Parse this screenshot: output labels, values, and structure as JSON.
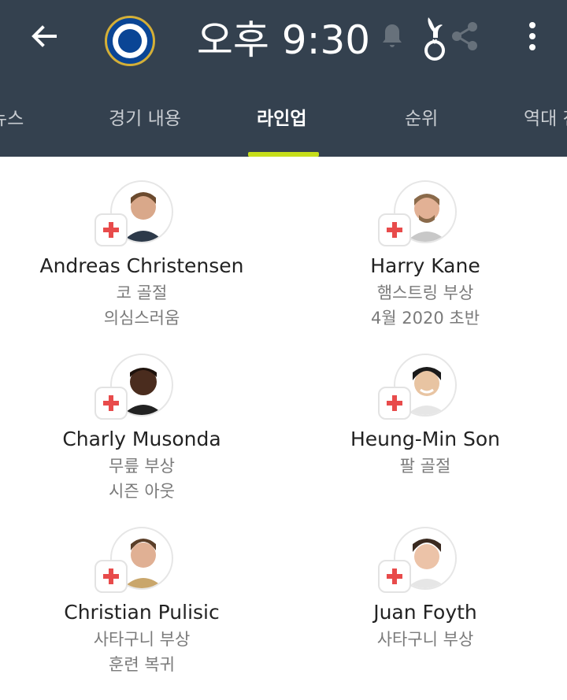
{
  "header": {
    "back_icon": "arrow-left-icon",
    "home_team_crest": "chelsea-crest-icon",
    "match_time": "오후 9:30",
    "away_team_crest": "tottenham-crest-icon",
    "menu_icon": "more-vert-icon"
  },
  "tabs": [
    {
      "label": "뉴스"
    },
    {
      "label": "경기 내용"
    },
    {
      "label": "라인업"
    },
    {
      "label": "순위"
    },
    {
      "label": "역대 전"
    }
  ],
  "accent_color": "#c6de1a",
  "header_color": "#34414f",
  "players": [
    {
      "name": "Andreas Christensen",
      "injury": "코 골절",
      "status": "의심스러움",
      "team": "home"
    },
    {
      "name": "Harry Kane",
      "injury": "햄스트링 부상",
      "status": "4월 2020 초반",
      "team": "away"
    },
    {
      "name": "Charly Musonda",
      "injury": "무릎 부상",
      "status": "시즌 아웃",
      "team": "home"
    },
    {
      "name": "Heung-Min Son",
      "injury": "팔 골절",
      "status": "",
      "team": "away"
    },
    {
      "name": "Christian Pulisic",
      "injury": "사타구니 부상",
      "status": "훈련 복귀",
      "team": "home"
    },
    {
      "name": "Juan Foyth",
      "injury": "사타구니 부상",
      "status": "",
      "team": "away"
    }
  ]
}
